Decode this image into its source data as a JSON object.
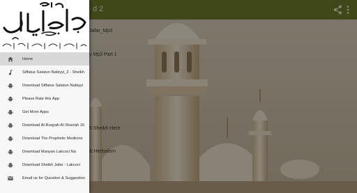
{
  "app_bar": {
    "title": "d 2",
    "color": "#6e7a2a",
    "actions": [
      {
        "name": "share-icon"
      },
      {
        "name": "more-vert-icon"
      }
    ]
  },
  "background_list": {
    "items": [
      "Jafar_Mp3",
      "y Mp3 Part 1",
      "5 Sheikh Here",
      "& Herbalism"
    ]
  },
  "drawer": {
    "header": {
      "logo_name": "salat-un-nabi-calligraphy-logo",
      "logo_text": "صلاة النبي"
    },
    "items": [
      {
        "label": "Home",
        "icon": "home-icon",
        "active": true
      },
      {
        "label": "Siffatus Salatun Nabiyyi_2 - Sheikh",
        "icon": "music-note-icon",
        "active": false
      },
      {
        "label": "Download Siffatus Salatun Nabiyyi",
        "icon": "android-icon",
        "active": false
      },
      {
        "label": "Please Rate this App",
        "icon": "android-icon",
        "active": false
      },
      {
        "label": "Get More Apps",
        "icon": "android-icon",
        "active": false
      },
      {
        "label": "Download Al-Ruqyah Al-Shariah 16",
        "icon": "android-icon",
        "active": false
      },
      {
        "label": "Download The Prophetic Medicine",
        "icon": "android-icon",
        "active": false
      },
      {
        "label": "Download Manyan Lakcoci Na",
        "icon": "android-icon",
        "active": false
      },
      {
        "label": "Download Sheikh Jafar - Lakcoci",
        "icon": "android-icon",
        "active": false
      },
      {
        "label": "Email us for Question & Suggestion",
        "icon": "email-icon",
        "active": false
      }
    ]
  }
}
